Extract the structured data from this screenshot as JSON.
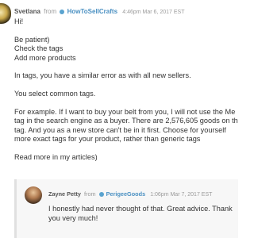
{
  "post": {
    "author": "Svetlana",
    "from": "from",
    "shop": "HowToSellCrafts",
    "time": "4:46pm Mar 6, 2017 EST",
    "lines": [
      "Hi!",
      "",
      "Be patient)",
      "Check the tags",
      "Add more products",
      "",
      "In tags, you have a similar error as with all new sellers.",
      "",
      "You select common tags.",
      "",
      "For example. If I want to buy your belt from you, I will not use the Me",
      "tag in the search engine as a buyer. There are 2,576,605 goods on th",
      "tag. And you as a new store can't be in it first. Choose for yourself",
      "more exact tags for your product, rather than generic tags",
      "",
      "Read more in my articles)"
    ]
  },
  "reply": {
    "author": "Zayne Petty",
    "from": "from",
    "shop": "PerigeeGoods",
    "time": "1:06pm Mar 7, 2017 EST",
    "lines": [
      "I honestly had never thought of that. Great advice. Thank",
      "you very much!"
    ]
  },
  "colors": {
    "shop_link": "#4a90c2",
    "reply_bg": "#f7f7f7"
  }
}
